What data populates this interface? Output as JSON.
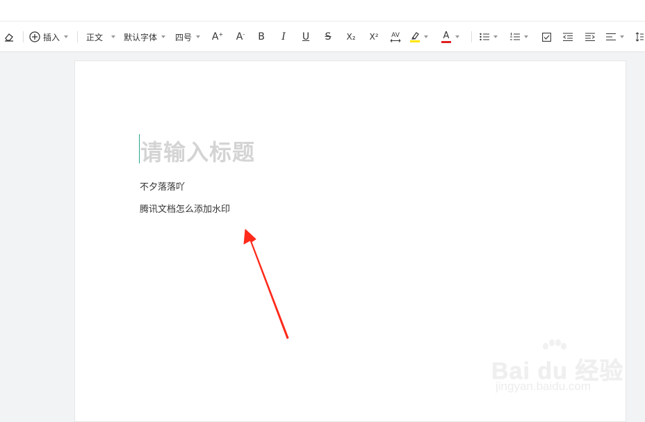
{
  "toolbar": {
    "insert_label": "插入",
    "style_label": "正文",
    "font_label": "默认字体",
    "size_label": "四号",
    "font_increase": "A",
    "font_decrease": "A",
    "bold": "B",
    "italic": "I",
    "underline": "U",
    "strike": "S",
    "subscript": "X₂",
    "superscript": "X²",
    "spacing": "AV",
    "highlight_color": "#ffe400",
    "text_color": "#e02020"
  },
  "document": {
    "title_placeholder": "请输入标题",
    "paragraphs": [
      "不夕落落吖",
      "腾讯文档怎么添加水印"
    ]
  },
  "annotation": {
    "arrow_color": "#ff2a1a"
  },
  "watermark": {
    "logo": "Bai du 经验",
    "url": "jingyan.baidu.com"
  }
}
